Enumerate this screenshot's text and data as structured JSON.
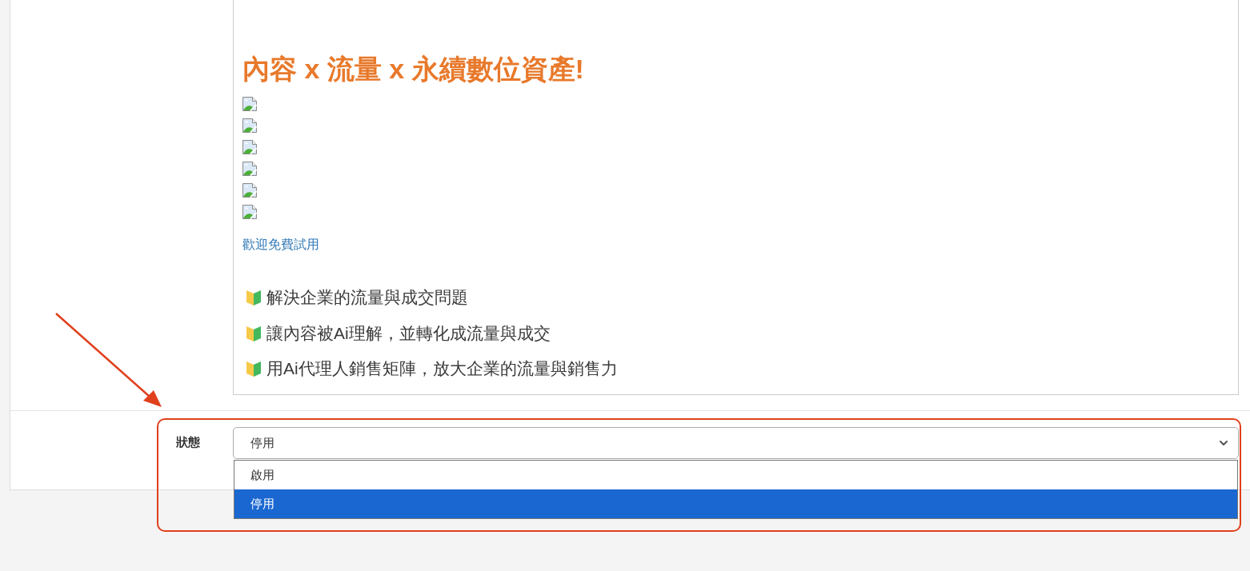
{
  "editor": {
    "heading": "內容 x 流量 x 永續數位資產!",
    "images": [
      {
        "kind": "broken"
      },
      {
        "kind": "broken"
      },
      {
        "kind": "broken"
      },
      {
        "kind": "broken"
      },
      {
        "kind": "broken"
      },
      {
        "kind": "broken"
      }
    ],
    "link": "歡迎免費試用",
    "bullets": [
      "解決企業的流量與成交問題",
      "讓內容被Ai理解，並轉化成流量與成交",
      "用Ai代理人銷售矩陣，放大企業的流量與銷售力"
    ]
  },
  "status": {
    "label": "狀態",
    "value": "停用",
    "expanded": true,
    "options": [
      {
        "label": "啟用",
        "selected": false
      },
      {
        "label": "停用",
        "selected": true
      }
    ]
  }
}
